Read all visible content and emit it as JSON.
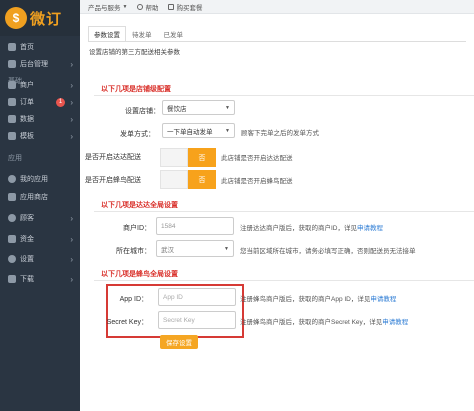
{
  "logo": {
    "badge": "$",
    "text": "微订"
  },
  "sidebar": {
    "items": [
      {
        "label": "首页"
      },
      {
        "label": "后台管理"
      },
      {
        "label": "基础"
      },
      {
        "label": "商户"
      },
      {
        "label": "订单",
        "badge": "1"
      },
      {
        "label": "数据"
      },
      {
        "label": "模板"
      },
      {
        "label": "应用"
      },
      {
        "label": "我的应用"
      },
      {
        "label": "应用商店"
      },
      {
        "label": "顾客"
      },
      {
        "label": "资金"
      },
      {
        "label": "设置"
      },
      {
        "label": "下载"
      }
    ]
  },
  "topbar": {
    "products": "产品与服务",
    "help": "帮助",
    "buy": "购买套餐"
  },
  "tabs": [
    "参数设置",
    "待发单",
    "已发单"
  ],
  "description": "设置店铺的第三方配送相关参数",
  "section1": {
    "title": "以下几项是店铺级配置",
    "store_label": "设置店铺：",
    "store_value": "餐饮店",
    "dispatch_label": "发单方式：",
    "dispatch_value": "一下单自动发单",
    "dispatch_hint": "顾客下完单之后的发单方式",
    "dada_label": "是否开启达达配送",
    "dada_toggle": "否",
    "dada_hint": "此店铺是否开启达达配送",
    "fengniao_label": "是否开启蜂鸟配送",
    "fengniao_toggle": "否",
    "fengniao_hint": "此店铺是否开启蜂鸟配送"
  },
  "section2": {
    "title": "以下几项是达达全局设置",
    "merchant_label": "商户ID：",
    "merchant_value": "1584",
    "merchant_hint": "注册达达商户版后，获取的商户ID，详见",
    "merchant_link": "申请教程",
    "city_label": "所在城市：",
    "city_value": "武汉",
    "city_hint": "您当前区域所在城市，请务必填写正确，否则配送员无法接单"
  },
  "section3": {
    "title": "以下几项是蜂鸟全局设置",
    "appid_label": "App ID：",
    "appid_placeholder": "App ID",
    "appid_hint": "注册蜂鸟商户版后，获取的商户App ID，详见",
    "appid_link": "申请教程",
    "secret_label": "Secret Key：",
    "secret_placeholder": "Secret Key",
    "secret_hint": "注册蜂鸟商户版后，获取的商户Secret Key，详见",
    "secret_link": "申请教程"
  },
  "save_label": "保存设置",
  "colors": {
    "sidebar": "#2a3542",
    "accent": "#f7a21b",
    "section_title": "#d9302a",
    "highlight": "#d63a35"
  }
}
